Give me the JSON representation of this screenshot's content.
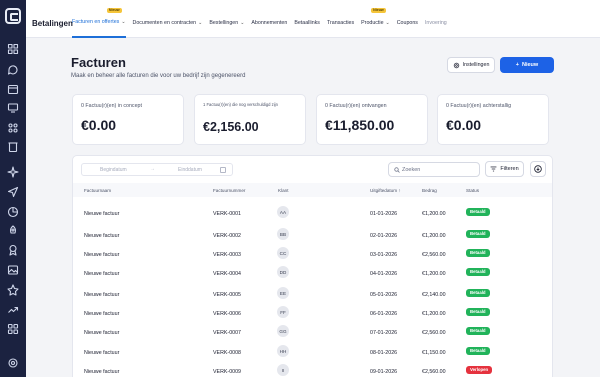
{
  "sidebar": {
    "icons": [
      "grid-icon",
      "chat-icon",
      "calendar-icon",
      "monitor-icon",
      "puzzle-icon",
      "trash-icon",
      "sparkle-icon",
      "send-icon",
      "chart-icon",
      "rocket-icon",
      "award-icon",
      "image-icon",
      "star-icon",
      "trend-icon",
      "apps-icon",
      "settings-icon"
    ]
  },
  "topbar": {
    "brand": "Betalingen",
    "nav": [
      {
        "label": "Facturen en offertes",
        "active": true,
        "chevron": true,
        "badge": "Nieuw"
      },
      {
        "label": "Documenten en contracten",
        "active": false,
        "chevron": true
      },
      {
        "label": "Bestellingen",
        "active": false,
        "chevron": true
      },
      {
        "label": "Abonnementen",
        "active": false,
        "chevron": false
      },
      {
        "label": "Betaallinks",
        "active": false,
        "chevron": false
      },
      {
        "label": "Transacties",
        "active": false,
        "chevron": false
      },
      {
        "label": "Productie",
        "active": false,
        "chevron": true,
        "badge": "Nieuw"
      },
      {
        "label": "Coupons",
        "active": false,
        "chevron": false
      },
      {
        "label": "Invoering",
        "active": false,
        "chevron": false,
        "faded": true
      }
    ]
  },
  "header": {
    "title": "Facturen",
    "subtitle": "Maak en beheer alle facturen die voor uw bedrijf zijn gegenereerd",
    "settings_label": "Instellingen",
    "new_label": "Nieuw"
  },
  "cards": [
    {
      "label": "0 Factuu(r)(en) in concept",
      "value": "€0.00"
    },
    {
      "label": "1 Factuu(r)(en) die nog verschuldigd zijn",
      "value": "€2,156.00"
    },
    {
      "label": "0 Factuu(r)(en) ontvangen",
      "value": "€11,850.00"
    },
    {
      "label": "0 Factuu(r)(en) achterstallig",
      "value": "€0.00"
    }
  ],
  "filters": {
    "start_placeholder": "Begindatum",
    "end_placeholder": "Einddatum",
    "arrow": "→",
    "search_placeholder": "Zoeken",
    "filter_label": "Filteren"
  },
  "table": {
    "headers": {
      "name": "Factuurnaam",
      "number": "Factuurnummer",
      "client": "Klant",
      "date": "Uitgiftedatum ↑",
      "amount": "Bedrag",
      "status": "Status"
    },
    "rows": [
      {
        "name": "Nieuwe factuur",
        "number": "VERK-0001",
        "client": "AA",
        "date": "01-01-2026",
        "amount": "€1,200.00",
        "status": "Betaald"
      },
      {
        "name": "Nieuwe factuur",
        "number": "VERK-0002",
        "client": "BB",
        "date": "02-01-2026",
        "amount": "€1,200.00",
        "status": "Betaald"
      },
      {
        "name": "Nieuwe factuur",
        "number": "VERK-0003",
        "client": "CC",
        "date": "03-01-2026",
        "amount": "€2,560.00",
        "status": "Betaald"
      },
      {
        "name": "Nieuwe factuur",
        "number": "VERK-0004",
        "client": "DD",
        "date": "04-01-2026",
        "amount": "€1,200.00",
        "status": "Betaald"
      },
      {
        "name": "Nieuwe factuur",
        "number": "VERK-0005",
        "client": "EE",
        "date": "05-01-2026",
        "amount": "€2,140.00",
        "status": "Betaald"
      },
      {
        "name": "Nieuwe factuur",
        "number": "VERK-0006",
        "client": "FF",
        "date": "06-01-2026",
        "amount": "€1,200.00",
        "status": "Betaald"
      },
      {
        "name": "Nieuwe factuur",
        "number": "VERK-0007",
        "client": "GG",
        "date": "07-01-2026",
        "amount": "€2,560.00",
        "status": "Betaald"
      },
      {
        "name": "Nieuwe factuur",
        "number": "VERK-0008",
        "client": "HH",
        "date": "08-01-2026",
        "amount": "€1,150.00",
        "status": "Betaald"
      },
      {
        "name": "Nieuwe factuur",
        "number": "VERK-0009",
        "client": "II",
        "date": "09-01-2026",
        "amount": "€2,560.00",
        "status": "Verlopen"
      }
    ]
  },
  "colors": {
    "sidebar": "#1b2240",
    "accent": "#1d62e6",
    "paid": "#21b35a",
    "overdue": "#e5323e",
    "badge": "#f5c53a"
  }
}
